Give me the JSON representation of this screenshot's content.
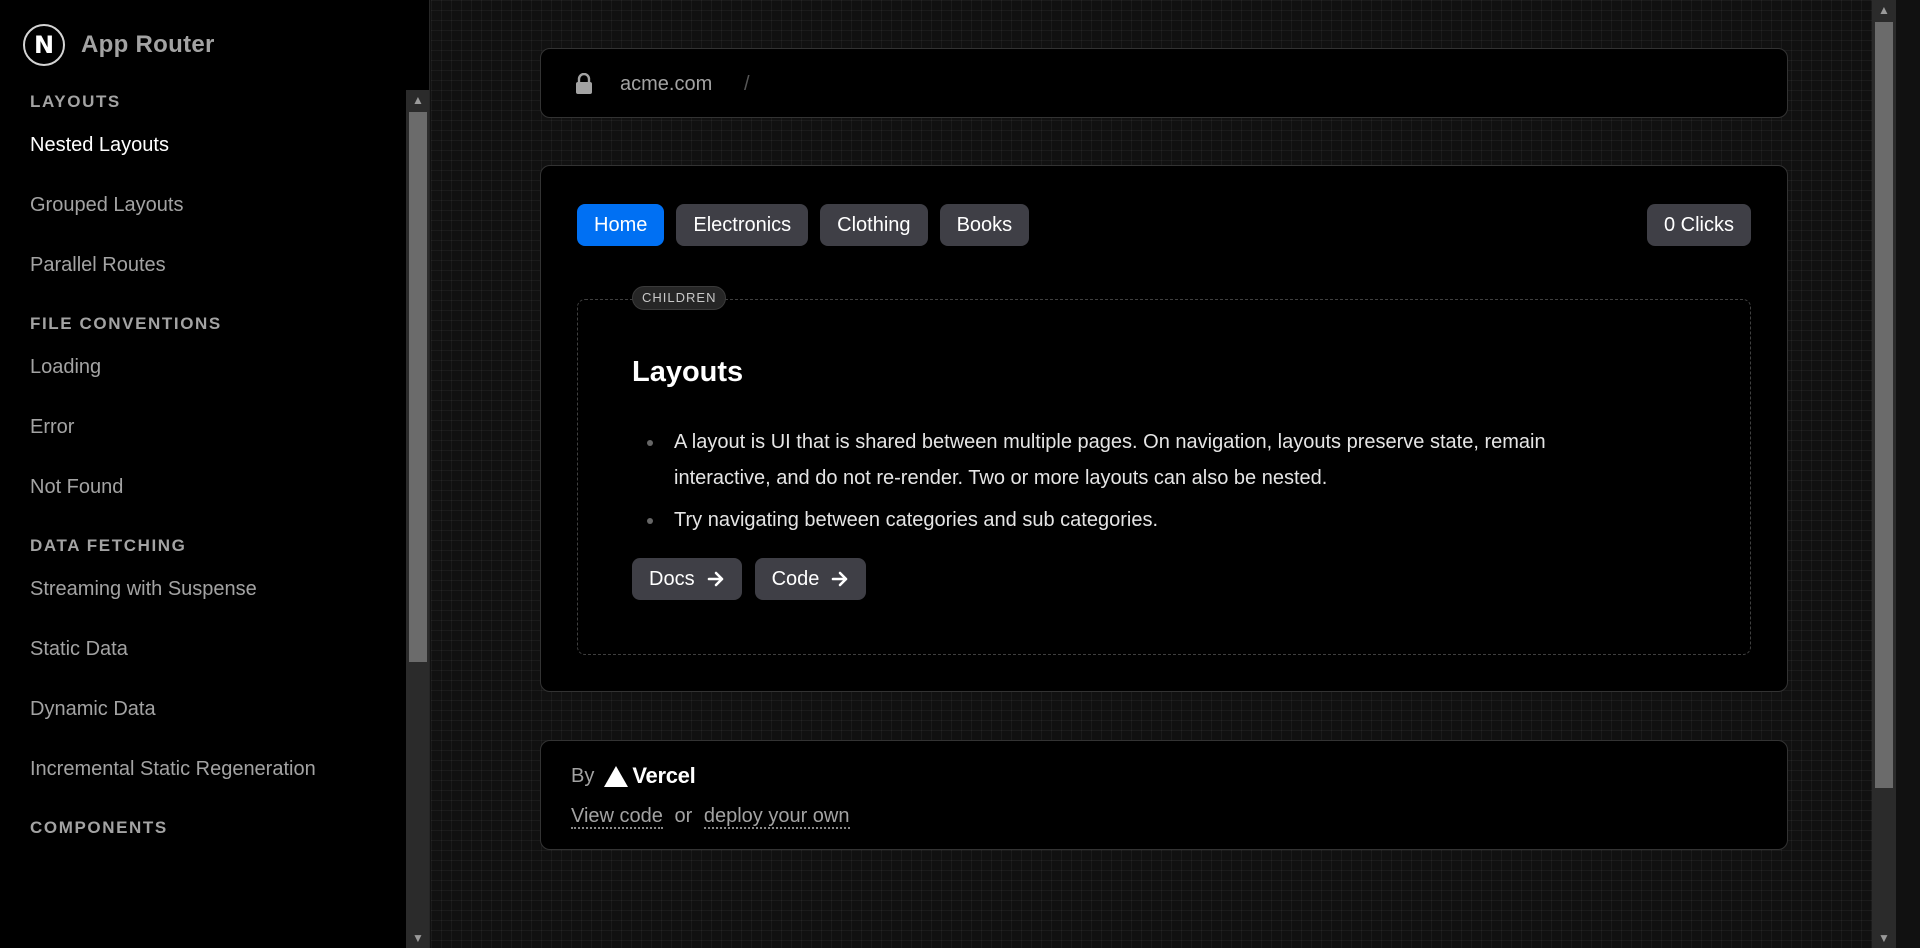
{
  "app": {
    "title": "App Router",
    "logo_letter": "N"
  },
  "sidebar": {
    "sections": [
      {
        "title": "Layouts",
        "items": [
          {
            "label": "Nested Layouts",
            "active": true
          },
          {
            "label": "Grouped Layouts",
            "active": false
          },
          {
            "label": "Parallel Routes",
            "active": false
          }
        ]
      },
      {
        "title": "File Conventions",
        "items": [
          {
            "label": "Loading",
            "active": false
          },
          {
            "label": "Error",
            "active": false
          },
          {
            "label": "Not Found",
            "active": false
          }
        ]
      },
      {
        "title": "Data Fetching",
        "items": [
          {
            "label": "Streaming with Suspense",
            "active": false
          },
          {
            "label": "Static Data",
            "active": false
          },
          {
            "label": "Dynamic Data",
            "active": false
          },
          {
            "label": "Incremental Static Regeneration",
            "active": false
          }
        ]
      },
      {
        "title": "Components",
        "items": []
      }
    ]
  },
  "address_bar": {
    "domain": "acme.com",
    "separator": "/"
  },
  "tabs": [
    {
      "label": "Home",
      "active": true
    },
    {
      "label": "Electronics",
      "active": false
    },
    {
      "label": "Clothing",
      "active": false
    },
    {
      "label": "Books",
      "active": false
    }
  ],
  "clicks": {
    "label": "0 Clicks"
  },
  "children": {
    "badge": "CHILDREN",
    "title": "Layouts",
    "bullets": [
      "A layout is UI that is shared between multiple pages. On navigation, layouts preserve state, remain interactive, and do not re-render. Two or more layouts can also be nested.",
      "Try navigating between categories and sub categories."
    ],
    "buttons": [
      {
        "label": "Docs"
      },
      {
        "label": "Code"
      }
    ]
  },
  "footer": {
    "by": "By",
    "brand": "Vercel",
    "view_code": "View code",
    "or": "or",
    "deploy": "deploy your own"
  },
  "colors": {
    "accent": "#0070f3",
    "button_bg": "#3f3f46",
    "page_bg": "#111111"
  }
}
